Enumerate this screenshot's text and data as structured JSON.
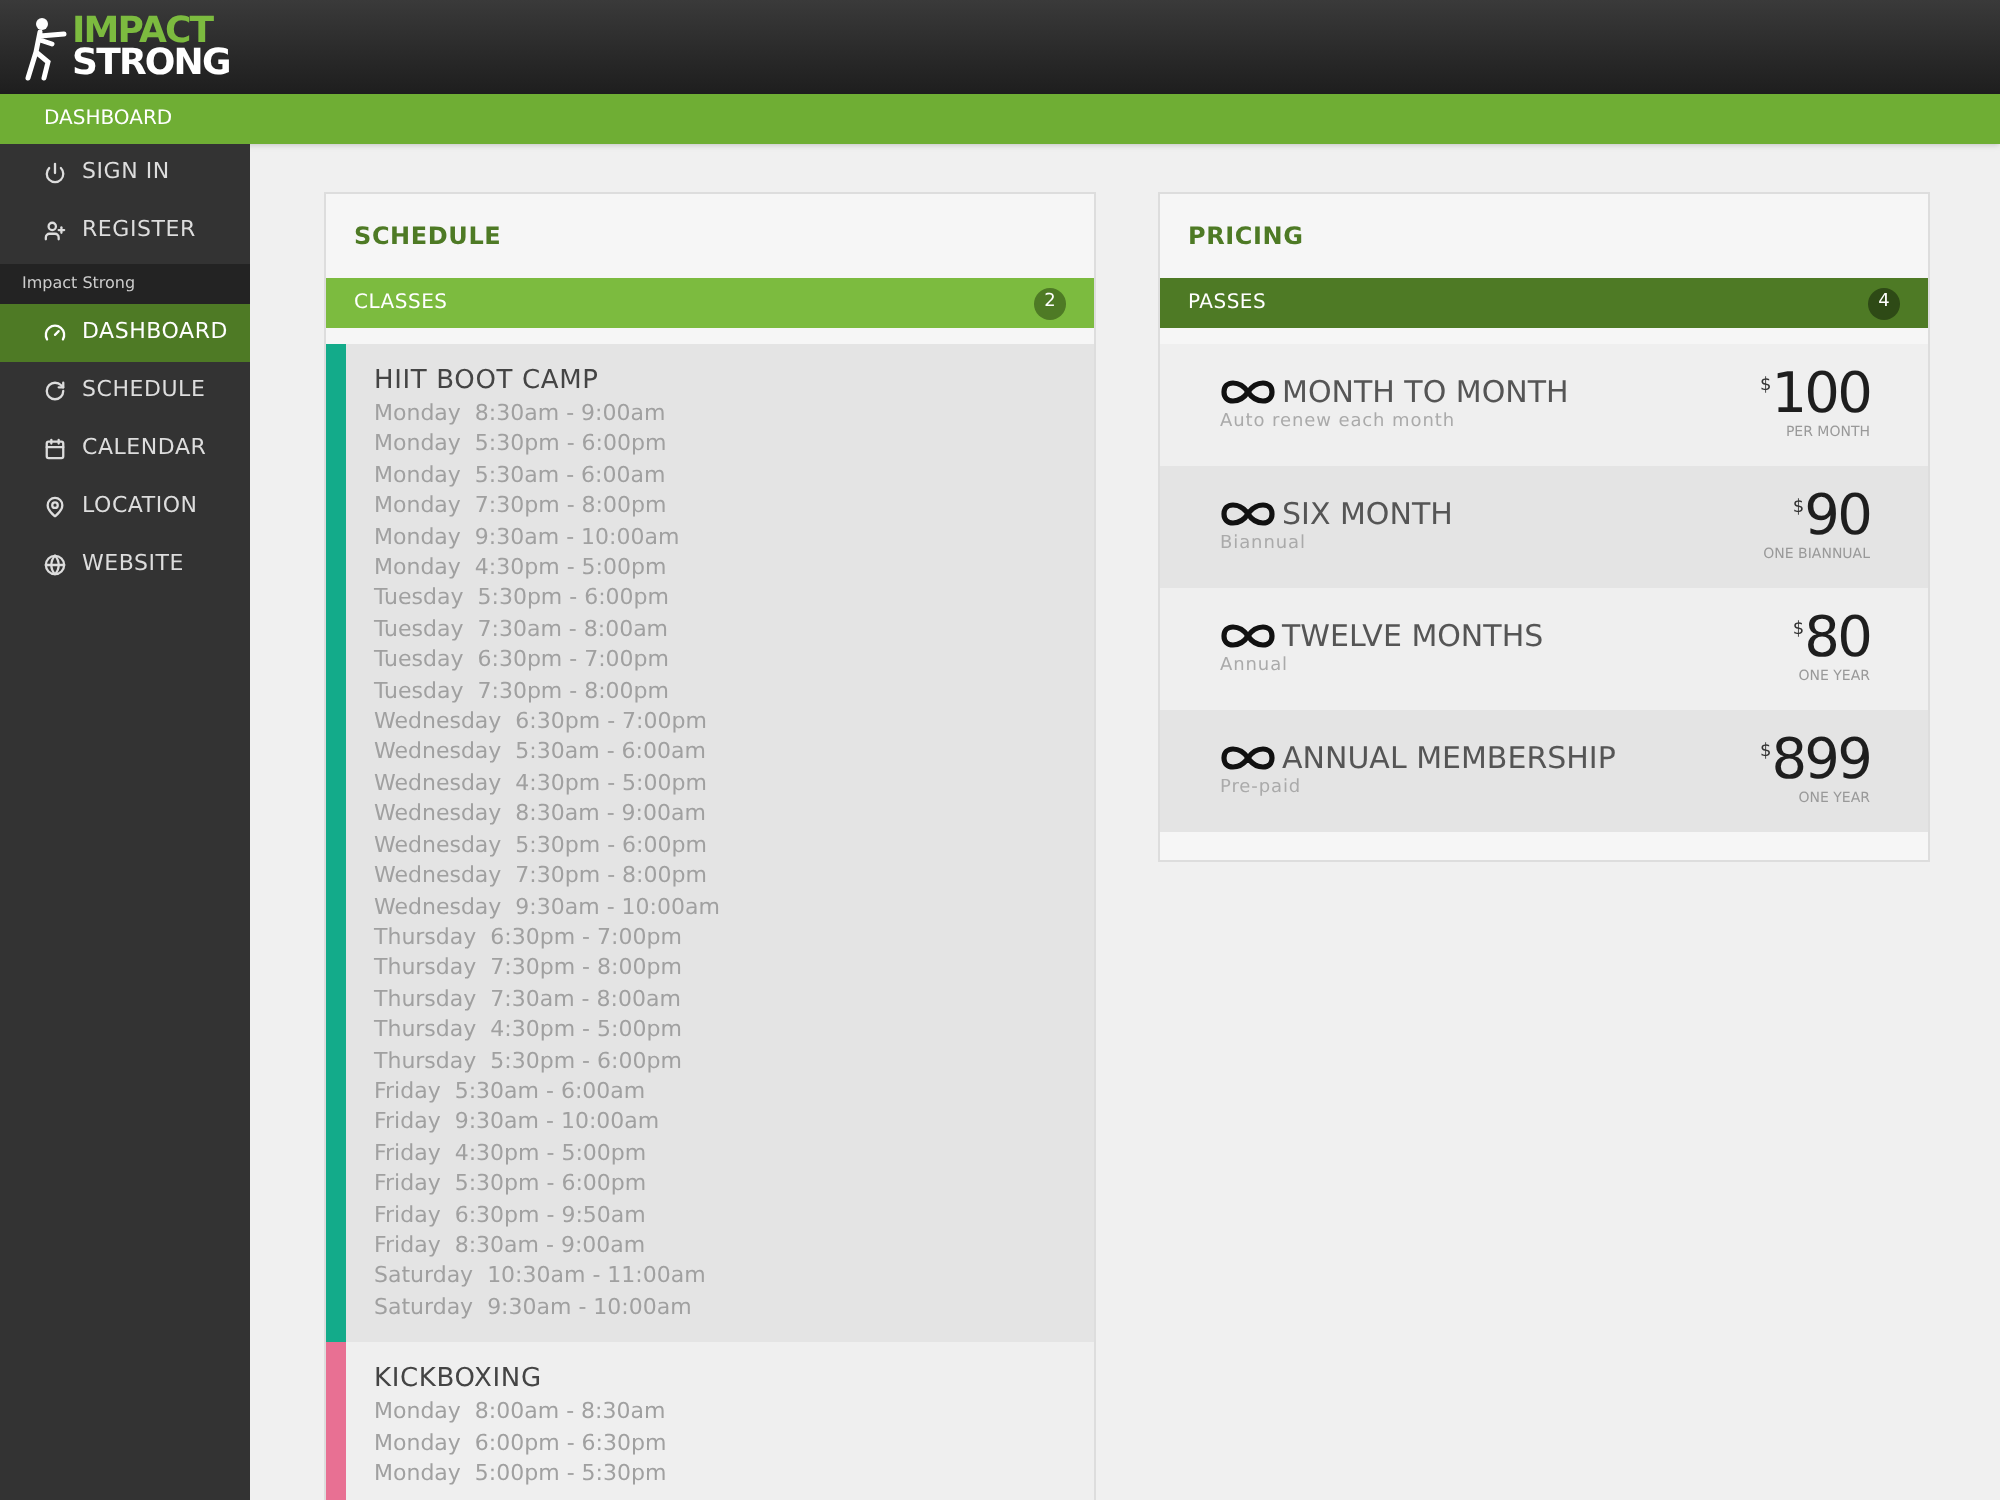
{
  "logo": {
    "line_1": "IMPACT",
    "line_2": "STRONG"
  },
  "top_bar": {
    "title": "DASHBOARD"
  },
  "sidebar": {
    "top_items": [
      {
        "label": "SIGN IN",
        "selected": false
      },
      {
        "label": "REGISTER",
        "selected": false
      }
    ],
    "section": "Impact Strong",
    "items": [
      {
        "label": "DASHBOARD",
        "selected": true
      },
      {
        "label": "SCHEDULE",
        "selected": false
      },
      {
        "label": "CALENDAR",
        "selected": false
      },
      {
        "label": "LOCATION",
        "selected": false
      },
      {
        "label": "WEBSITE",
        "selected": false
      }
    ]
  },
  "schedule": {
    "title": "SCHEDULE",
    "bar": {
      "label": "CLASSES",
      "count": "2"
    },
    "classes": [
      {
        "name": "HIIT BOOT CAMP",
        "color": "#13ab8a",
        "times": [
          "Monday  8:30am - 9:00am",
          "Monday  5:30pm - 6:00pm",
          "Monday  5:30am - 6:00am",
          "Monday  7:30pm - 8:00pm",
          "Monday  9:30am - 10:00am",
          "Monday  4:30pm - 5:00pm",
          "Tuesday  5:30pm - 6:00pm",
          "Tuesday  7:30am - 8:00am",
          "Tuesday  6:30pm - 7:00pm",
          "Tuesday  7:30pm - 8:00pm",
          "Wednesday  6:30pm - 7:00pm",
          "Wednesday  5:30am - 6:00am",
          "Wednesday  4:30pm - 5:00pm",
          "Wednesday  8:30am - 9:00am",
          "Wednesday  5:30pm - 6:00pm",
          "Wednesday  7:30pm - 8:00pm",
          "Wednesday  9:30am - 10:00am",
          "Thursday  6:30pm - 7:00pm",
          "Thursday  7:30pm - 8:00pm",
          "Thursday  7:30am - 8:00am",
          "Thursday  4:30pm - 5:00pm",
          "Thursday  5:30pm - 6:00pm",
          "Friday  5:30am - 6:00am",
          "Friday  9:30am - 10:00am",
          "Friday  4:30pm - 5:00pm",
          "Friday  5:30pm - 6:00pm",
          "Friday  6:30pm - 9:50am",
          "Friday  8:30am - 9:00am",
          "Saturday  10:30am - 11:00am",
          "Saturday  9:30am - 10:00am"
        ]
      },
      {
        "name": "KICKBOXING",
        "color": "#e87093",
        "times": [
          "Monday  8:00am - 8:30am",
          "Monday  6:00pm - 6:30pm",
          "Monday  5:00pm - 5:30pm"
        ]
      }
    ]
  },
  "pricing": {
    "title": "PRICING",
    "bar": {
      "label": "PASSES",
      "count": "4"
    },
    "passes": [
      {
        "name": "MONTH TO MONTH",
        "subtitle": "Auto renew each month",
        "currency": "$",
        "price": "100",
        "period": "PER MONTH"
      },
      {
        "name": "SIX MONTH",
        "subtitle": "Biannual",
        "currency": "$",
        "price": "90",
        "period": "ONE BIANNUAL"
      },
      {
        "name": "TWELVE MONTHS",
        "subtitle": "Annual",
        "currency": "$",
        "price": "80",
        "period": "ONE YEAR"
      },
      {
        "name": "ANNUAL MEMBERSHIP",
        "subtitle": "Pre-paid",
        "currency": "$",
        "price": "899",
        "period": "ONE YEAR"
      }
    ]
  }
}
